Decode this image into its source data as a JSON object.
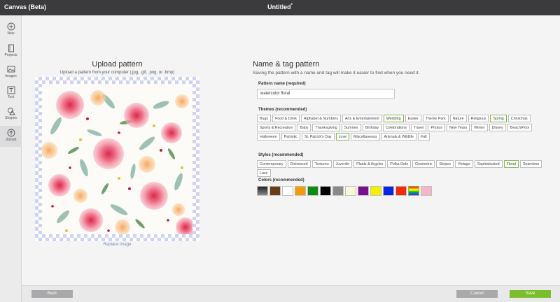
{
  "app_title": "Canvas (Beta)",
  "document": {
    "title": "Untitled",
    "modified_marker": "*"
  },
  "sidebar": {
    "items": [
      {
        "label": "New",
        "icon": "plus-circle-icon"
      },
      {
        "label": "Projects",
        "icon": "projects-icon"
      },
      {
        "label": "Images",
        "icon": "image-icon"
      },
      {
        "label": "Text",
        "icon": "text-icon"
      },
      {
        "label": "Shapes",
        "icon": "shapes-icon"
      },
      {
        "label": "Upload",
        "icon": "upload-icon",
        "active": true
      }
    ]
  },
  "upload": {
    "title": "Upload pattern",
    "subtitle": "Upload a pattern from your computer (.jpg, .gif, .png, or .bmp)",
    "replace_label": "Replace image"
  },
  "tagging": {
    "title": "Name & tag pattern",
    "subtitle": "Saving the pattern with a name and tag will make it easier to find when you need it.",
    "name_label": "Pattern name (required)",
    "name_value": "watercolor floral",
    "themes_label": "Themes (recommended)",
    "themes": [
      {
        "label": "Bugs",
        "selected": false
      },
      {
        "label": "Food & Drink",
        "selected": false
      },
      {
        "label": "Alphabet & Numbers",
        "selected": false
      },
      {
        "label": "Arts & Entertainment",
        "selected": false
      },
      {
        "label": "Wedding",
        "selected": true
      },
      {
        "label": "Easter",
        "selected": false
      },
      {
        "label": "Theme Park",
        "selected": false
      },
      {
        "label": "Nature",
        "selected": false
      },
      {
        "label": "Religious",
        "selected": false
      },
      {
        "label": "Spring",
        "selected": true
      },
      {
        "label": "Christmas",
        "selected": false
      },
      {
        "label": "Sports & Recreation",
        "selected": false
      },
      {
        "label": "Baby",
        "selected": false
      },
      {
        "label": "Thanksgiving",
        "selected": false
      },
      {
        "label": "Summer",
        "selected": false
      },
      {
        "label": "Birthday",
        "selected": false
      },
      {
        "label": "Celebrations",
        "selected": false
      },
      {
        "label": "Travel",
        "selected": false
      },
      {
        "label": "Photos",
        "selected": false
      },
      {
        "label": "New Years",
        "selected": false
      },
      {
        "label": "Winter",
        "selected": false
      },
      {
        "label": "Disney",
        "selected": false
      },
      {
        "label": "Beach/Pool",
        "selected": false
      },
      {
        "label": "Halloween",
        "selected": false
      },
      {
        "label": "Patriotic",
        "selected": false
      },
      {
        "label": "St. Patrick's Day",
        "selected": false
      },
      {
        "label": "Love",
        "selected": true
      },
      {
        "label": "Miscellaneous",
        "selected": false
      },
      {
        "label": "Animals & Wildlife",
        "selected": false
      },
      {
        "label": "Fall",
        "selected": false
      }
    ],
    "styles_label": "Styles (recommended)",
    "styles": [
      {
        "label": "Contemporary",
        "selected": false
      },
      {
        "label": "Distressed",
        "selected": false
      },
      {
        "label": "Textures",
        "selected": false
      },
      {
        "label": "Juvenile",
        "selected": false
      },
      {
        "label": "Plaids & Argyles",
        "selected": false
      },
      {
        "label": "Polka Dots",
        "selected": false
      },
      {
        "label": "Geometric",
        "selected": false
      },
      {
        "label": "Stripes",
        "selected": false
      },
      {
        "label": "Vintage",
        "selected": false
      },
      {
        "label": "Sophisticated",
        "selected": false
      },
      {
        "label": "Floral",
        "selected": true
      },
      {
        "label": "Seamless",
        "selected": false
      },
      {
        "label": "Lace",
        "selected": false
      }
    ],
    "colors_label": "Colors (recommended)",
    "colors": [
      {
        "name": "gray-gradient",
        "fill": "linear-gradient(180deg,#222 0%,#888 100%)",
        "selected": false
      },
      {
        "name": "brown",
        "fill": "#6b3d16",
        "selected": false
      },
      {
        "name": "white",
        "fill": "#ffffff",
        "selected": false
      },
      {
        "name": "orange",
        "fill": "#f59a0c",
        "selected": false
      },
      {
        "name": "green",
        "fill": "#0d8a12",
        "selected": false
      },
      {
        "name": "black",
        "fill": "#000000",
        "selected": false
      },
      {
        "name": "gray",
        "fill": "#8a8a8a",
        "selected": false
      },
      {
        "name": "cream",
        "fill": "#fbf7d7",
        "selected": false
      },
      {
        "name": "purple",
        "fill": "#7c0d8c",
        "selected": false
      },
      {
        "name": "yellow",
        "fill": "#f6f000",
        "selected": false
      },
      {
        "name": "blue",
        "fill": "#0a25e8",
        "selected": false
      },
      {
        "name": "red",
        "fill": "#f02a0b",
        "selected": false
      },
      {
        "name": "rainbow",
        "fill": "linear-gradient(180deg,#f00 0%,#f90 20%,#ff0 40%,#0c0 60%,#06f 80%,#90f 100%)",
        "selected": true
      },
      {
        "name": "pink",
        "fill": "#f7b6c7",
        "selected": false
      }
    ]
  },
  "footer": {
    "back_label": "Back",
    "cancel_label": "Cancel",
    "save_label": "Save"
  },
  "colors": {
    "topbar": "#3b3b3d",
    "accent_green": "#7cbd2d",
    "selected_border": "#7bbf4a"
  }
}
